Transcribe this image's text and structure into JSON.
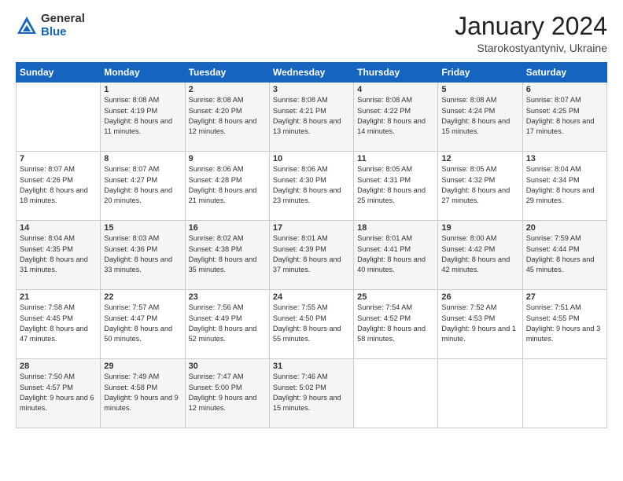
{
  "logo": {
    "general": "General",
    "blue": "Blue"
  },
  "header": {
    "month": "January 2024",
    "location": "Starokostyantyniv, Ukraine"
  },
  "weekdays": [
    "Sunday",
    "Monday",
    "Tuesday",
    "Wednesday",
    "Thursday",
    "Friday",
    "Saturday"
  ],
  "weeks": [
    [
      {
        "day": "",
        "sunrise": "",
        "sunset": "",
        "daylight": ""
      },
      {
        "day": "1",
        "sunrise": "Sunrise: 8:08 AM",
        "sunset": "Sunset: 4:19 PM",
        "daylight": "Daylight: 8 hours and 11 minutes."
      },
      {
        "day": "2",
        "sunrise": "Sunrise: 8:08 AM",
        "sunset": "Sunset: 4:20 PM",
        "daylight": "Daylight: 8 hours and 12 minutes."
      },
      {
        "day": "3",
        "sunrise": "Sunrise: 8:08 AM",
        "sunset": "Sunset: 4:21 PM",
        "daylight": "Daylight: 8 hours and 13 minutes."
      },
      {
        "day": "4",
        "sunrise": "Sunrise: 8:08 AM",
        "sunset": "Sunset: 4:22 PM",
        "daylight": "Daylight: 8 hours and 14 minutes."
      },
      {
        "day": "5",
        "sunrise": "Sunrise: 8:08 AM",
        "sunset": "Sunset: 4:24 PM",
        "daylight": "Daylight: 8 hours and 15 minutes."
      },
      {
        "day": "6",
        "sunrise": "Sunrise: 8:07 AM",
        "sunset": "Sunset: 4:25 PM",
        "daylight": "Daylight: 8 hours and 17 minutes."
      }
    ],
    [
      {
        "day": "7",
        "sunrise": "Sunrise: 8:07 AM",
        "sunset": "Sunset: 4:26 PM",
        "daylight": "Daylight: 8 hours and 18 minutes."
      },
      {
        "day": "8",
        "sunrise": "Sunrise: 8:07 AM",
        "sunset": "Sunset: 4:27 PM",
        "daylight": "Daylight: 8 hours and 20 minutes."
      },
      {
        "day": "9",
        "sunrise": "Sunrise: 8:06 AM",
        "sunset": "Sunset: 4:28 PM",
        "daylight": "Daylight: 8 hours and 21 minutes."
      },
      {
        "day": "10",
        "sunrise": "Sunrise: 8:06 AM",
        "sunset": "Sunset: 4:30 PM",
        "daylight": "Daylight: 8 hours and 23 minutes."
      },
      {
        "day": "11",
        "sunrise": "Sunrise: 8:05 AM",
        "sunset": "Sunset: 4:31 PM",
        "daylight": "Daylight: 8 hours and 25 minutes."
      },
      {
        "day": "12",
        "sunrise": "Sunrise: 8:05 AM",
        "sunset": "Sunset: 4:32 PM",
        "daylight": "Daylight: 8 hours and 27 minutes."
      },
      {
        "day": "13",
        "sunrise": "Sunrise: 8:04 AM",
        "sunset": "Sunset: 4:34 PM",
        "daylight": "Daylight: 8 hours and 29 minutes."
      }
    ],
    [
      {
        "day": "14",
        "sunrise": "Sunrise: 8:04 AM",
        "sunset": "Sunset: 4:35 PM",
        "daylight": "Daylight: 8 hours and 31 minutes."
      },
      {
        "day": "15",
        "sunrise": "Sunrise: 8:03 AM",
        "sunset": "Sunset: 4:36 PM",
        "daylight": "Daylight: 8 hours and 33 minutes."
      },
      {
        "day": "16",
        "sunrise": "Sunrise: 8:02 AM",
        "sunset": "Sunset: 4:38 PM",
        "daylight": "Daylight: 8 hours and 35 minutes."
      },
      {
        "day": "17",
        "sunrise": "Sunrise: 8:01 AM",
        "sunset": "Sunset: 4:39 PM",
        "daylight": "Daylight: 8 hours and 37 minutes."
      },
      {
        "day": "18",
        "sunrise": "Sunrise: 8:01 AM",
        "sunset": "Sunset: 4:41 PM",
        "daylight": "Daylight: 8 hours and 40 minutes."
      },
      {
        "day": "19",
        "sunrise": "Sunrise: 8:00 AM",
        "sunset": "Sunset: 4:42 PM",
        "daylight": "Daylight: 8 hours and 42 minutes."
      },
      {
        "day": "20",
        "sunrise": "Sunrise: 7:59 AM",
        "sunset": "Sunset: 4:44 PM",
        "daylight": "Daylight: 8 hours and 45 minutes."
      }
    ],
    [
      {
        "day": "21",
        "sunrise": "Sunrise: 7:58 AM",
        "sunset": "Sunset: 4:45 PM",
        "daylight": "Daylight: 8 hours and 47 minutes."
      },
      {
        "day": "22",
        "sunrise": "Sunrise: 7:57 AM",
        "sunset": "Sunset: 4:47 PM",
        "daylight": "Daylight: 8 hours and 50 minutes."
      },
      {
        "day": "23",
        "sunrise": "Sunrise: 7:56 AM",
        "sunset": "Sunset: 4:49 PM",
        "daylight": "Daylight: 8 hours and 52 minutes."
      },
      {
        "day": "24",
        "sunrise": "Sunrise: 7:55 AM",
        "sunset": "Sunset: 4:50 PM",
        "daylight": "Daylight: 8 hours and 55 minutes."
      },
      {
        "day": "25",
        "sunrise": "Sunrise: 7:54 AM",
        "sunset": "Sunset: 4:52 PM",
        "daylight": "Daylight: 8 hours and 58 minutes."
      },
      {
        "day": "26",
        "sunrise": "Sunrise: 7:52 AM",
        "sunset": "Sunset: 4:53 PM",
        "daylight": "Daylight: 9 hours and 1 minute."
      },
      {
        "day": "27",
        "sunrise": "Sunrise: 7:51 AM",
        "sunset": "Sunset: 4:55 PM",
        "daylight": "Daylight: 9 hours and 3 minutes."
      }
    ],
    [
      {
        "day": "28",
        "sunrise": "Sunrise: 7:50 AM",
        "sunset": "Sunset: 4:57 PM",
        "daylight": "Daylight: 9 hours and 6 minutes."
      },
      {
        "day": "29",
        "sunrise": "Sunrise: 7:49 AM",
        "sunset": "Sunset: 4:58 PM",
        "daylight": "Daylight: 9 hours and 9 minutes."
      },
      {
        "day": "30",
        "sunrise": "Sunrise: 7:47 AM",
        "sunset": "Sunset: 5:00 PM",
        "daylight": "Daylight: 9 hours and 12 minutes."
      },
      {
        "day": "31",
        "sunrise": "Sunrise: 7:46 AM",
        "sunset": "Sunset: 5:02 PM",
        "daylight": "Daylight: 9 hours and 15 minutes."
      },
      {
        "day": "",
        "sunrise": "",
        "sunset": "",
        "daylight": ""
      },
      {
        "day": "",
        "sunrise": "",
        "sunset": "",
        "daylight": ""
      },
      {
        "day": "",
        "sunrise": "",
        "sunset": "",
        "daylight": ""
      }
    ]
  ]
}
